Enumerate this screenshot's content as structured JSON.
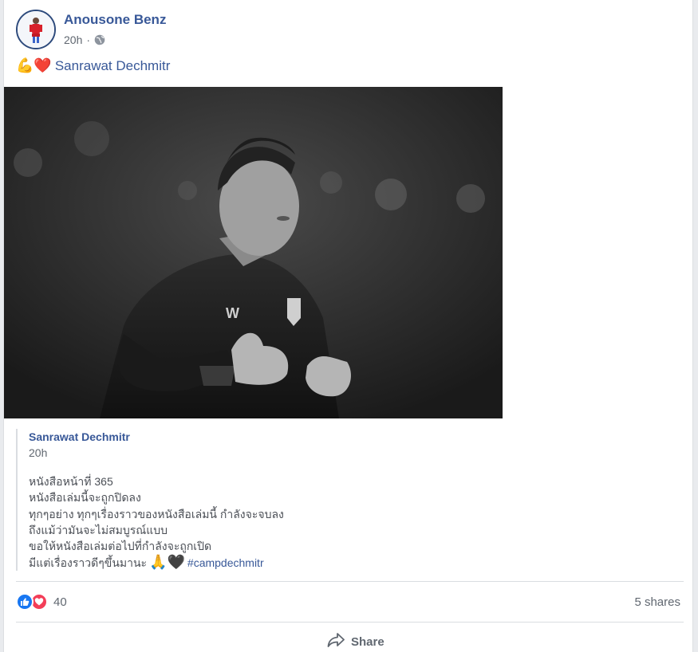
{
  "post": {
    "author": "Anousone Benz",
    "time": "20h",
    "separator": "·",
    "emojis": "💪❤️",
    "mention": "Sanrawat Dechmitr"
  },
  "shared_post": {
    "author": "Sanrawat Dechmitr",
    "time": "20h",
    "lines": [
      "หนังสือหน้าที่ 365",
      "หนังสือเล่มนี้จะถูกปิดลง",
      "ทุกๆอย่าง ทุกๆเรื่องราวของหนังสือเล่มนี้ กำลังจะจบลง",
      "ถึงแม้ว่ามันจะไม่สมบูรณ์แบบ",
      "ขอให้หนังสือเล่มต่อไปที่กำลังจะถูกเปิด",
      "มีแต่เรื่องราวดีๆขึ้นมานะ"
    ],
    "last_line_emojis": "🙏🖤",
    "hashtag": "#campdechmitr"
  },
  "footer": {
    "reaction_count": "40",
    "shares": "5 shares",
    "share_label": "Share"
  },
  "icons": {
    "privacy": "globe-icon",
    "like": "like-icon",
    "love": "love-icon",
    "share": "share-icon"
  },
  "colors": {
    "link": "#385898",
    "like": "#1877f2",
    "love": "#f33e58",
    "text": "#1c1e21",
    "muted": "#606770"
  }
}
